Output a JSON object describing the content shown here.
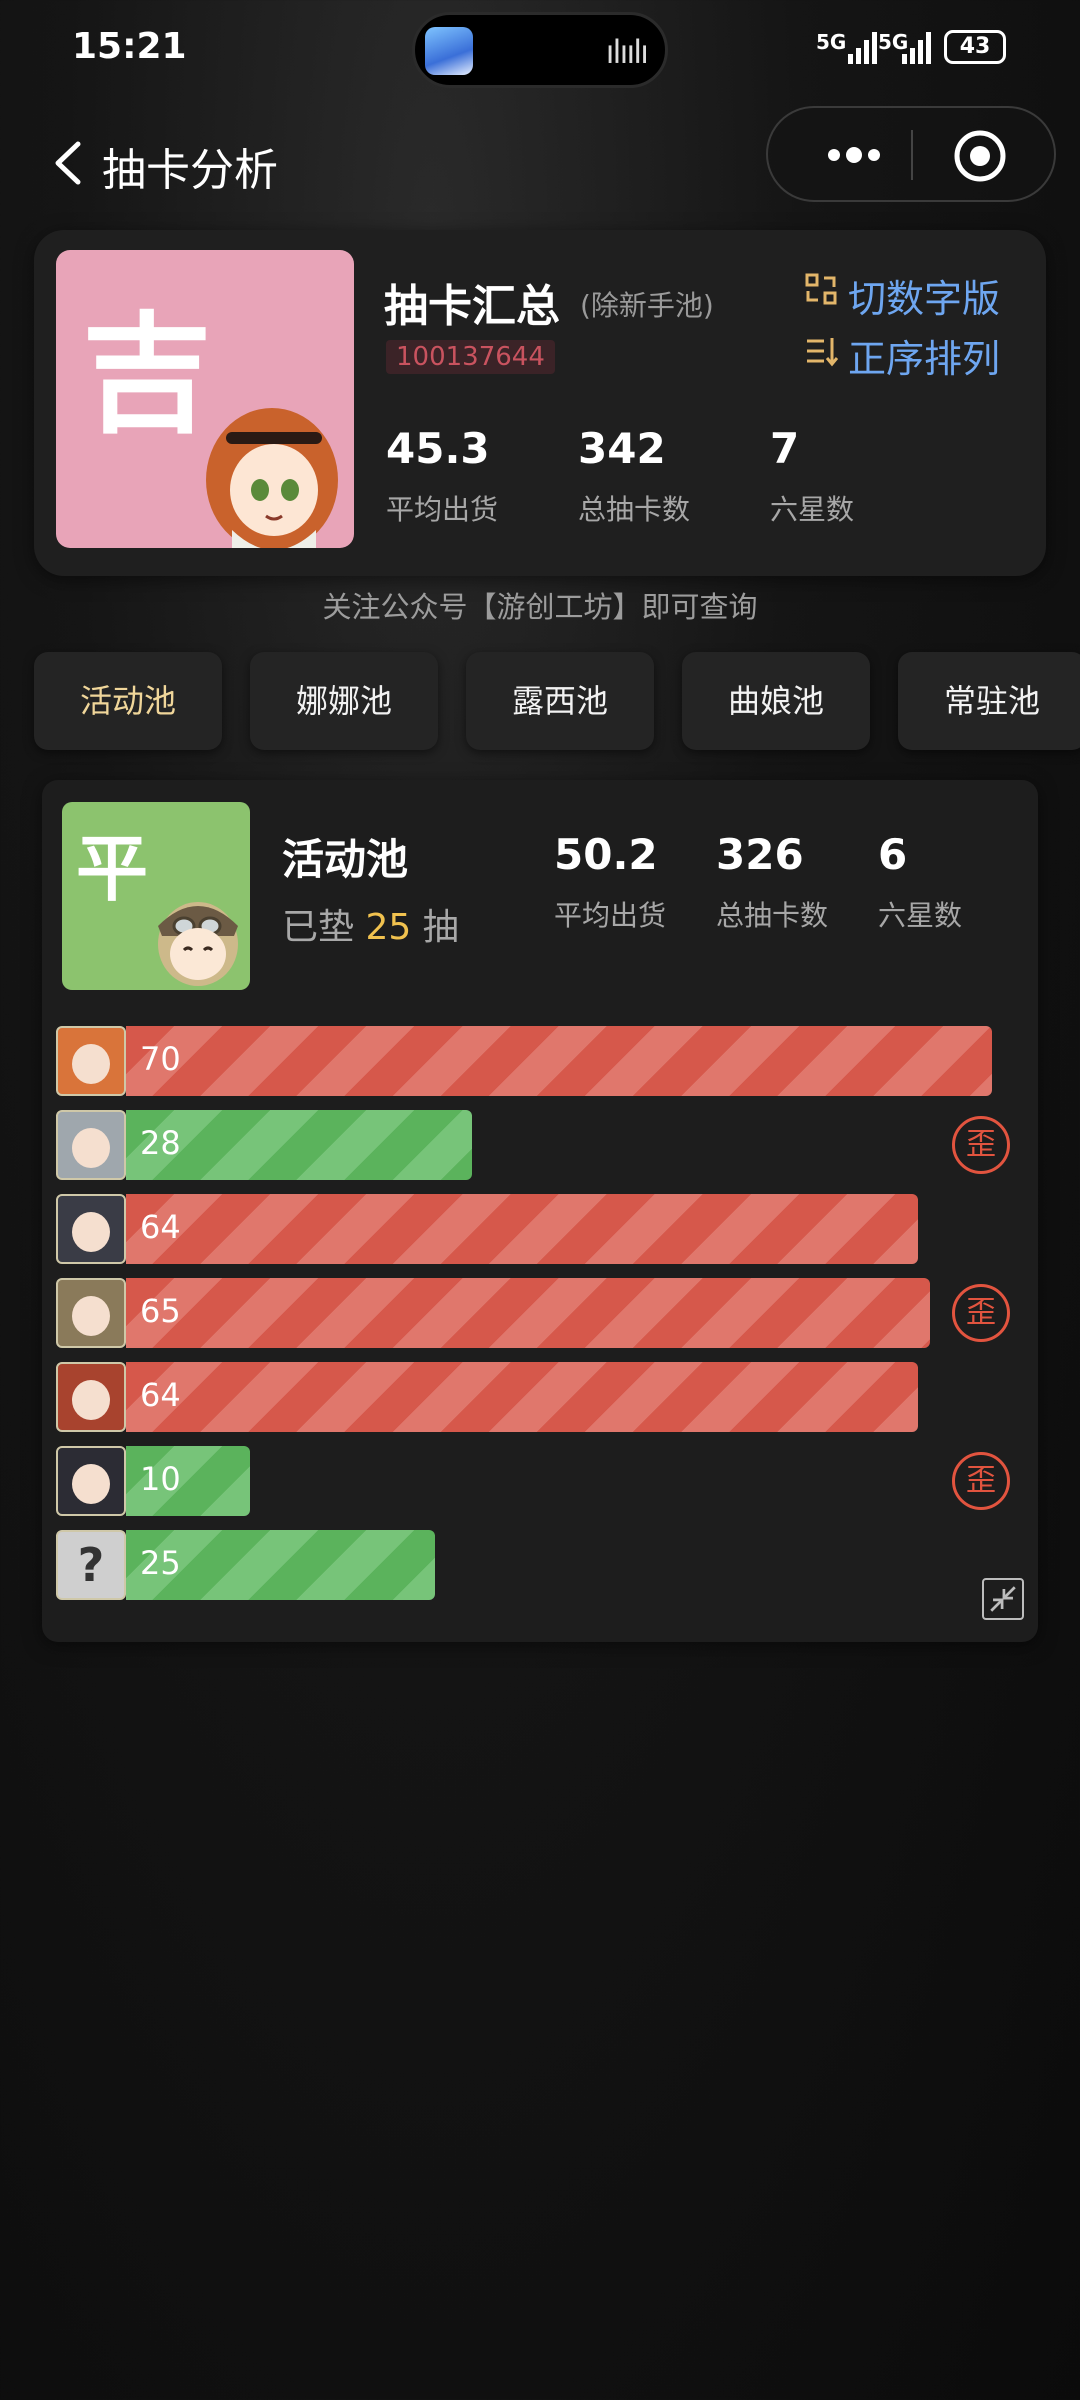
{
  "status": {
    "time": "15:21",
    "signal_1": "5G",
    "signal_2": "5G",
    "battery": "43"
  },
  "header": {
    "title": "抽卡分析"
  },
  "summary": {
    "title": "抽卡汇总",
    "subtitle": "(除新手池)",
    "uid": "100137644",
    "luck_char": "吉",
    "switch_label": "切数字版",
    "sort_label": "正序排列",
    "stats": [
      {
        "value": "45.3",
        "label": "平均出货"
      },
      {
        "value": "342",
        "label": "总抽卡数"
      },
      {
        "value": "7",
        "label": "六星数"
      }
    ]
  },
  "hint": "关注公众号【游创工坊】即可查询",
  "tabs": [
    "活动池",
    "娜娜池",
    "露西池",
    "曲娘池",
    "常驻池"
  ],
  "active_tab": 0,
  "pool": {
    "luck_char": "平",
    "name": "活动池",
    "pity_prefix": "已垫",
    "pity_count": "25",
    "pity_suffix": "抽",
    "stats": [
      {
        "value": "50.2",
        "label": "平均出货"
      },
      {
        "value": "326",
        "label": "总抽卡数"
      },
      {
        "value": "6",
        "label": "六星数"
      }
    ],
    "wai_label": "歪",
    "pulls": [
      {
        "count": 70,
        "color": "red",
        "off_banner": false,
        "avatar": "char-avatar-orange-hair"
      },
      {
        "count": 28,
        "color": "green",
        "off_banner": true,
        "avatar": "char-avatar-silver-hair"
      },
      {
        "count": 64,
        "color": "red",
        "off_banner": false,
        "avatar": "char-avatar-witch-hat"
      },
      {
        "count": 65,
        "color": "red",
        "off_banner": true,
        "avatar": "char-avatar-aviator-cap"
      },
      {
        "count": 64,
        "color": "red",
        "off_banner": false,
        "avatar": "char-avatar-red-hair"
      },
      {
        "count": 10,
        "color": "green",
        "off_banner": true,
        "avatar": "char-avatar-black-hair"
      },
      {
        "count": 25,
        "color": "green",
        "off_banner": false,
        "avatar": "unknown-avatar",
        "avatar_text": "?"
      }
    ]
  }
}
